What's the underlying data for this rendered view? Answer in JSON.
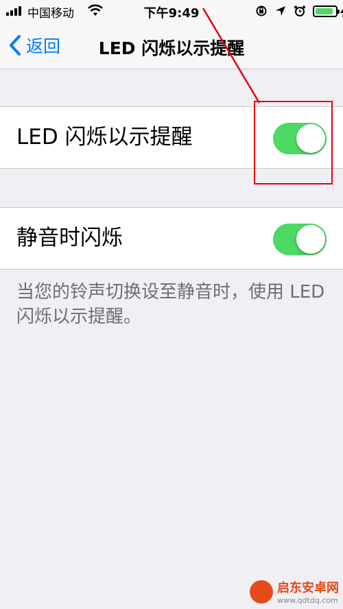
{
  "status_bar": {
    "carrier": "中国移动",
    "time": "下午9:49",
    "battery_level": 0.9,
    "icons": [
      "signal-icon",
      "wifi-icon",
      "orientation-lock-icon",
      "location-icon",
      "alarm-icon",
      "battery-icon",
      "charging-icon"
    ]
  },
  "nav": {
    "back_label": "返回",
    "title": "LED 闪烁以示提醒"
  },
  "settings": [
    {
      "label": "LED 闪烁以示提醒",
      "enabled": true
    },
    {
      "label": "静音时闪烁",
      "enabled": true
    }
  ],
  "footer_note": "当您的铃声切换设至静音时，使用 LED 闪烁以示提醒。",
  "watermark": {
    "name": "启东安卓网",
    "url": "www.qdtdq.com"
  },
  "colors": {
    "accent": "#007aff",
    "toggle_on": "#4cd964",
    "annotation": "#e60012",
    "background": "#efeff4"
  }
}
